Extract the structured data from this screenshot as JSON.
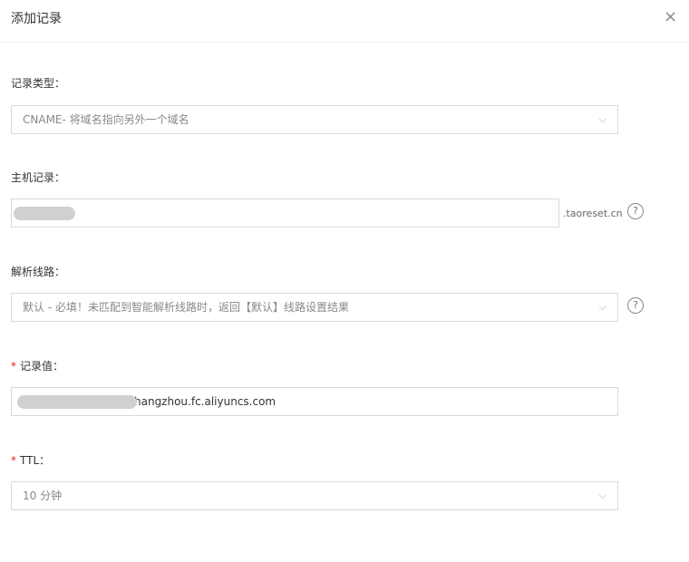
{
  "dialog": {
    "title": "添加记录",
    "close": "×"
  },
  "fields": {
    "record_type": {
      "label": "记录类型：",
      "value": "CNAME- 将域名指向另外一个域名"
    },
    "host": {
      "label": "主机记录：",
      "value": "",
      "suffix": ".taoreset.cn"
    },
    "line": {
      "label": "解析线路：",
      "value": "默认 - 必填！未匹配到智能解析线路时，返回【默认】线路设置结果"
    },
    "record_value": {
      "label": "记录值：",
      "required": "*",
      "value": "hangzhou.fc.aliyuncs.com"
    },
    "ttl": {
      "label": "TTL：",
      "required": "*",
      "value": "10 分钟"
    }
  },
  "icons": {
    "chevron": "⌵",
    "help": "?"
  }
}
